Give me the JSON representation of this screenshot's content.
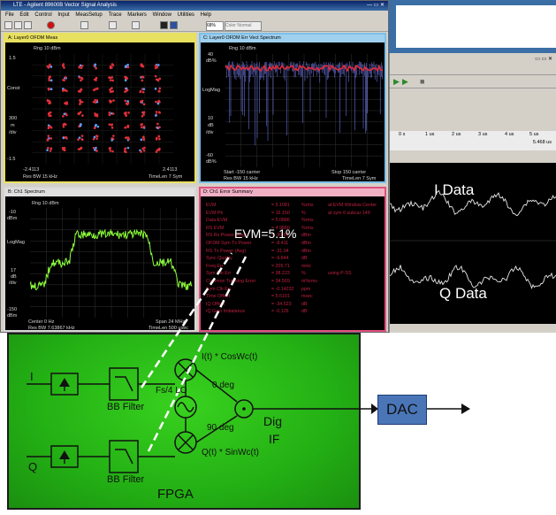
{
  "vsa": {
    "title": "LTE - Agilent 89600B Vector Signal Analysis",
    "menu": [
      "File",
      "Edit",
      "Control",
      "Input",
      "MeasSetup",
      "Trace",
      "Markers",
      "Window",
      "Utilities",
      "Help"
    ],
    "toolbar_zoom": "68%",
    "toolbar_color": "Color Normal"
  },
  "pane_a": {
    "header": "A: Layer0 OFDM Meas",
    "range": "Rng 10 dBm",
    "y_top": "1.5",
    "y_label": "Const",
    "y_mid": "300",
    "y_unit": "m",
    "y_div": "/div",
    "y_bottom": "-1.5",
    "x_left": "-2.4113",
    "x_right": "2.4113",
    "res_bw": "Res BW 15 kHz",
    "timelen": "TimeLen 7 Sym"
  },
  "pane_c": {
    "header": "C: Layer0 OFDM Err Vect Spectrum",
    "range": "Rng 10 dBm",
    "y_top": "40",
    "y_top_unit": "dB%",
    "y_label": "LogMag",
    "y_mid": "10",
    "y_unit": "dB",
    "y_div": "/div",
    "y_bottom": "-60",
    "y_bottom_unit": "dB%",
    "x_left": "Start -150 carrier",
    "x_right": "Stop 150 carrier",
    "res_bw": "Res BW 15 kHz",
    "timelen": "TimeLen 7 Sym"
  },
  "pane_b": {
    "header": "B: Ch1 Spectrum",
    "range": "Rng 10 dBm",
    "y_top": "-10",
    "y_top_unit": "dBm",
    "y_label": "LogMag",
    "y_mid": "17",
    "y_unit": "dB",
    "y_div": "/div",
    "y_bottom": "-150",
    "y_bottom_unit": "dBm",
    "x_left": "Center 0  Hz",
    "x_right": "Span 24 MHz",
    "res_bw": "Res BW 7.63867 kHz",
    "timelen": "TimeLen 500 usec"
  },
  "pane_d": {
    "header": "D: Ch1 Error Summary",
    "rows": [
      {
        "label": "EVM",
        "value": "= 5.1081",
        "unit": "%rms",
        "extra": "at  EVM Window Center"
      },
      {
        "label": "EVM Pk",
        "value": "= 16.150",
        "unit": "%",
        "extra": "at  sym 6  subcar 149"
      },
      {
        "label": "Data EVM",
        "value": "= 5.0886",
        "unit": "%rms",
        "extra": ""
      },
      {
        "label": "RS EVM",
        "value": "= 4.9860",
        "unit": "%rms",
        "extra": ""
      },
      {
        "label": "RS Rx Power (Avg)",
        "value": "= -30.64",
        "unit": "dBm",
        "extra": ""
      },
      {
        "label": "OFDM Sym Tx Power",
        "value": "= -8.411",
        "unit": "dBm",
        "extra": ""
      },
      {
        "label": "RS Tx Power (Avg)",
        "value": "= -31.04",
        "unit": "dBm",
        "extra": ""
      },
      {
        "label": "Sync Quality",
        "value": "= -9.844",
        "unit": "dB",
        "extra": ""
      },
      {
        "label": "Freq Err",
        "value": "= 205.71",
        "unit": "mHz",
        "extra": ""
      },
      {
        "label": "Sym Clk Err",
        "value": "= 98.223",
        "unit": "%",
        "extra": "using  P-SS"
      },
      {
        "label": "Common Tracking Error",
        "value": "= 34.569",
        "unit": "m%rms",
        "extra": ""
      },
      {
        "label": "Sym Clk Err",
        "value": "= -0.14232",
        "unit": "ppm",
        "extra": ""
      },
      {
        "label": "Time Offset",
        "value": "= 5.5101",
        "unit": "msec",
        "extra": ""
      },
      {
        "label": "IQ Offset",
        "value": "= -34.523",
        "unit": "dB",
        "extra": ""
      },
      {
        "label": "IQ Gain Imbalance",
        "value": "= -0.126",
        "unit": "dB",
        "extra": ""
      }
    ],
    "evm_callout": "EVM=5.1%"
  },
  "app2": {
    "time_ticks": [
      "0 s",
      "1 us",
      "2 us",
      "3 us",
      "4 us",
      "5 us"
    ],
    "time_readout": "5.468 us",
    "i_label": "I Data",
    "q_label": "Q Data"
  },
  "fpga": {
    "label": "FPGA",
    "i_input": "I",
    "q_input": "Q",
    "bb_filter_top": "BB Filter",
    "bb_filter_bottom": "BB Filter",
    "i_mix": "I(t) * CosWc(t)",
    "q_mix": "Q(t) * SinWc(t)",
    "lo": "Fs/4 LO",
    "deg0": "0 deg",
    "deg90": "90 deg",
    "dig_if_1": "Dig",
    "dig_if_2": "IF",
    "dac": "DAC"
  },
  "colors": {
    "fpga_green": "#2bbd18",
    "dac_blue": "#4a76b8",
    "trace_green": "#8cff3a",
    "trace_red": "#e02a3a",
    "constellation_red": "#e0303a",
    "constellation_blue": "#5aa0ff"
  }
}
